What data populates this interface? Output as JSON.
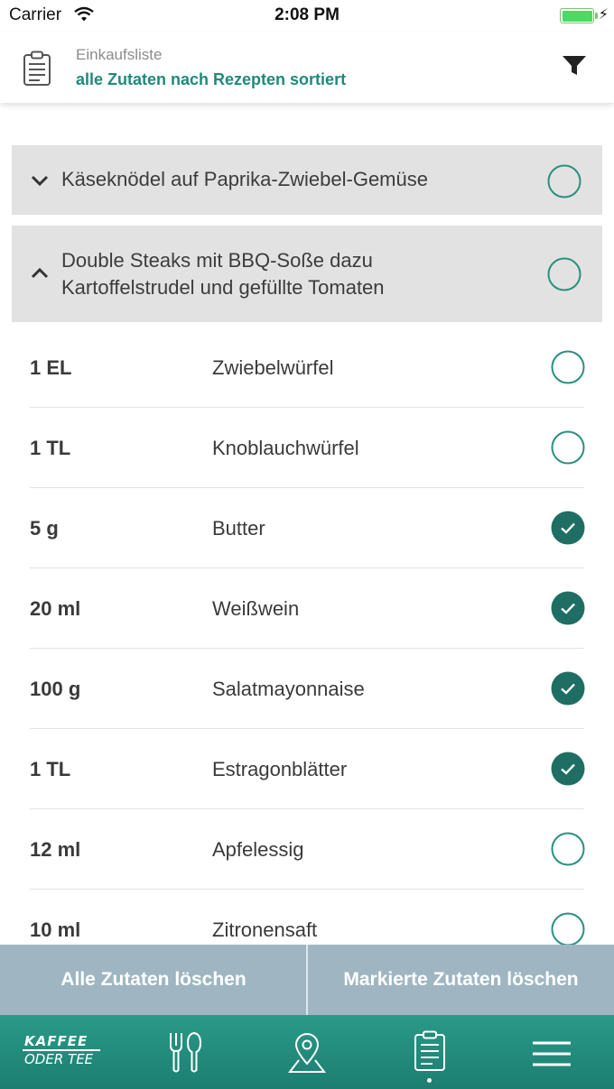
{
  "status_bar": {
    "carrier": "Carrier",
    "time": "2:08 PM"
  },
  "header": {
    "title": "Einkaufsliste",
    "subtitle": "alle Zutaten nach Rezepten sortiert",
    "icons": [
      "clipboard-list-icon",
      "filter-icon"
    ]
  },
  "recipes": [
    {
      "title_lines": [
        "Käseknödel auf Paprika-Zwiebel-Gemüse"
      ],
      "expanded": false,
      "checked": false
    },
    {
      "title_lines": [
        "Double Steaks mit BBQ-Soße dazu",
        "Kartoffelstrudel und gefüllte Tomaten"
      ],
      "expanded": true,
      "checked": false
    }
  ],
  "ingredients": [
    {
      "qty": "1 EL",
      "name": "Zwiebelwürfel",
      "checked": false
    },
    {
      "qty": "1 TL",
      "name": "Knoblauchwürfel",
      "checked": false
    },
    {
      "qty": "5 g",
      "name": "Butter",
      "checked": true
    },
    {
      "qty": "20 ml",
      "name": "Weißwein",
      "checked": true
    },
    {
      "qty": "100 g",
      "name": "Salatmayonnaise",
      "checked": true
    },
    {
      "qty": "1 TL",
      "name": "Estragonblätter",
      "checked": true
    },
    {
      "qty": "12 ml",
      "name": "Apfelessig",
      "checked": false
    },
    {
      "qty": "10 ml",
      "name": "Zitronensaft",
      "checked": false
    }
  ],
  "actions": {
    "delete_all": "Alle Zutaten löschen",
    "delete_marked": "Markierte Zutaten löschen"
  },
  "tab_bar": {
    "logo_line1": "KAFFEE",
    "logo_line2": "ODER TEE",
    "tabs": [
      "cutlery-icon",
      "location-pin-icon",
      "clipboard-list-icon",
      "menu-icon"
    ],
    "active_tab": 2
  },
  "colors": {
    "accent": "#1f8a7a",
    "check_filled": "#1e6e63",
    "check_outline": "#2a8f80",
    "recipe_bg": "#e2e2e2",
    "action_bar": "#9fb6c2",
    "tab_bar": "#22897a"
  }
}
